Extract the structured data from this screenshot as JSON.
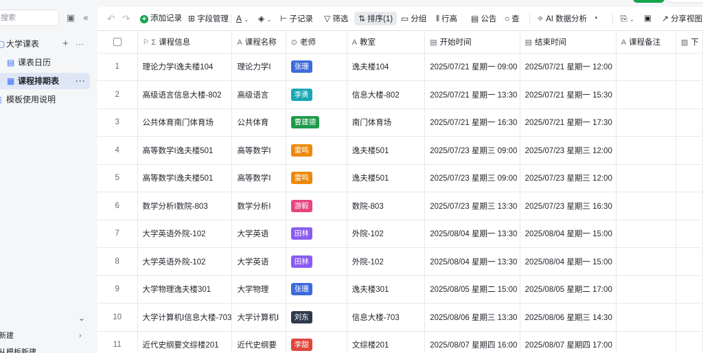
{
  "sidebar": {
    "search_placeholder": "搜索",
    "base_name": "大学课表",
    "add_icon": "plus-icon",
    "more_icon": "ellipsis-icon",
    "items": [
      {
        "label": "课表日历",
        "icon": "calendar-icon"
      },
      {
        "label": "课程排期表",
        "icon": "grid-table-icon",
        "active": true
      },
      {
        "label": "模板使用说明",
        "icon": "doc-icon"
      }
    ],
    "bottom_items": [
      {
        "label": "新建"
      },
      {
        "label": "从模板新建"
      }
    ]
  },
  "toolbar": {
    "add_record": "添加记录",
    "field_manage": "字段管理",
    "sub_record": "子记录",
    "filter": "筛选",
    "sort": "排序(1)",
    "group": "分组",
    "row_height": "行高",
    "notice": "公告",
    "find": "查",
    "ai_analysis": "AI 数据分析",
    "share_view": "分享视图"
  },
  "table": {
    "columns": [
      "课程信息",
      "课程名称",
      "老师",
      "教室",
      "开始时间",
      "结束时间",
      "课程备注",
      "下"
    ],
    "rows": [
      {
        "n": "1",
        "info": "理论力学I逸夫楼104",
        "name": "理论力学I",
        "teacher": "张珊",
        "color": "#3d6bdb",
        "room": "逸夫楼104",
        "start": "2025/07/21 星期一 09:00",
        "end": "2025/07/21 星期一 12:00"
      },
      {
        "n": "2",
        "info": "高级语言信息大楼-802",
        "name": "高级语言",
        "teacher": "李勇",
        "color": "#1aa7b3",
        "room": "信息大楼-802",
        "start": "2025/07/21 星期一 13:30",
        "end": "2025/07/21 星期一 15:30"
      },
      {
        "n": "3",
        "info": "公共体育南门体育场",
        "name": "公共体育",
        "teacher": "曹建德",
        "color": "#1e9a4a",
        "room": "南门体育场",
        "start": "2025/07/21 星期一 16:30",
        "end": "2025/07/21 星期一 17:30"
      },
      {
        "n": "4",
        "info": "高等数学I逸夫楼501",
        "name": "高等数学I",
        "teacher": "雷鸣",
        "color": "#ed8a0c",
        "room": "逸夫楼501",
        "start": "2025/07/23 星期三 09:00",
        "end": "2025/07/23 星期三 12:00"
      },
      {
        "n": "5",
        "info": "高等数学I逸夫楼501",
        "name": "高等数学I",
        "teacher": "雷鸣",
        "color": "#ed8a0c",
        "room": "逸夫楼501",
        "start": "2025/07/23 星期三 09:00",
        "end": "2025/07/23 星期三 12:00"
      },
      {
        "n": "6",
        "info": "数学分析I数院-803",
        "name": "数学分析I",
        "teacher": "游毅",
        "color": "#e64680",
        "room": "数院-803",
        "start": "2025/07/23 星期三 13:30",
        "end": "2025/07/23 星期三 16:30"
      },
      {
        "n": "7",
        "info": "大学英语外院-102",
        "name": "大学英语",
        "teacher": "田林",
        "color": "#8a5cf0",
        "room": "外院-102",
        "start": "2025/08/04 星期一 13:30",
        "end": "2025/08/04 星期一 15:00"
      },
      {
        "n": "8",
        "info": "大学英语外院-102",
        "name": "大学英语",
        "teacher": "田林",
        "color": "#8a5cf0",
        "room": "外院-102",
        "start": "2025/08/04 星期一 13:30",
        "end": "2025/08/04 星期一 15:00"
      },
      {
        "n": "9",
        "info": "大学物理逸夫楼301",
        "name": "大学物理",
        "teacher": "张珊",
        "color": "#3d6bdb",
        "room": "逸夫楼301",
        "start": "2025/08/05 星期二 15:00",
        "end": "2025/08/05 星期二 17:00"
      },
      {
        "n": "10",
        "info": "大学计算机Ⅰ信息大楼-703",
        "name": "大学计算机Ⅰ",
        "teacher": "刘东",
        "color": "#2f3a4d",
        "room": "信息大楼-703",
        "start": "2025/08/06 星期三 13:30",
        "end": "2025/08/06 星期三 14:30"
      },
      {
        "n": "11",
        "info": "近代史纲要文综楼201",
        "name": "近代史纲要",
        "teacher": "李甜",
        "color": "#e0463c",
        "room": "文综楼201",
        "start": "2025/08/07 星期四 16:00",
        "end": "2025/08/07 星期四 17:00"
      }
    ]
  }
}
